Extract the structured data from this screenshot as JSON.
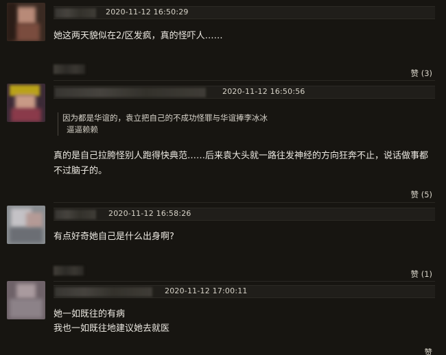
{
  "comments": [
    {
      "timestamp": "2020-11-12 16:50:29",
      "text": "她这两天貌似在2/区发疯，真的怪吓人……",
      "like_label": "赞",
      "like_count": "(3)"
    },
    {
      "timestamp": "2020-11-12 16:50:56",
      "quote_text": "因为都是华谊的，袁立把自己的不成功怪罪与华谊捧李冰冰",
      "quote_author": "逼逼赖赖",
      "text": "真的是自己拉胯怪别人跑得快典范……后来袁大头就一路往发神经的方向狂奔不止，说话做事都不过脑子的。",
      "like_label": "赞",
      "like_count": "(5)"
    },
    {
      "timestamp": "2020-11-12 16:58:26",
      "text": "有点好奇她自己是什么出身啊?",
      "like_label": "赞",
      "like_count": "(1)"
    },
    {
      "timestamp": "2020-11-12 17:00:11",
      "text_line1": "她一如既往的有病",
      "text_line2": "我也一如既往地建议她去就医",
      "like_label": "赞"
    }
  ]
}
